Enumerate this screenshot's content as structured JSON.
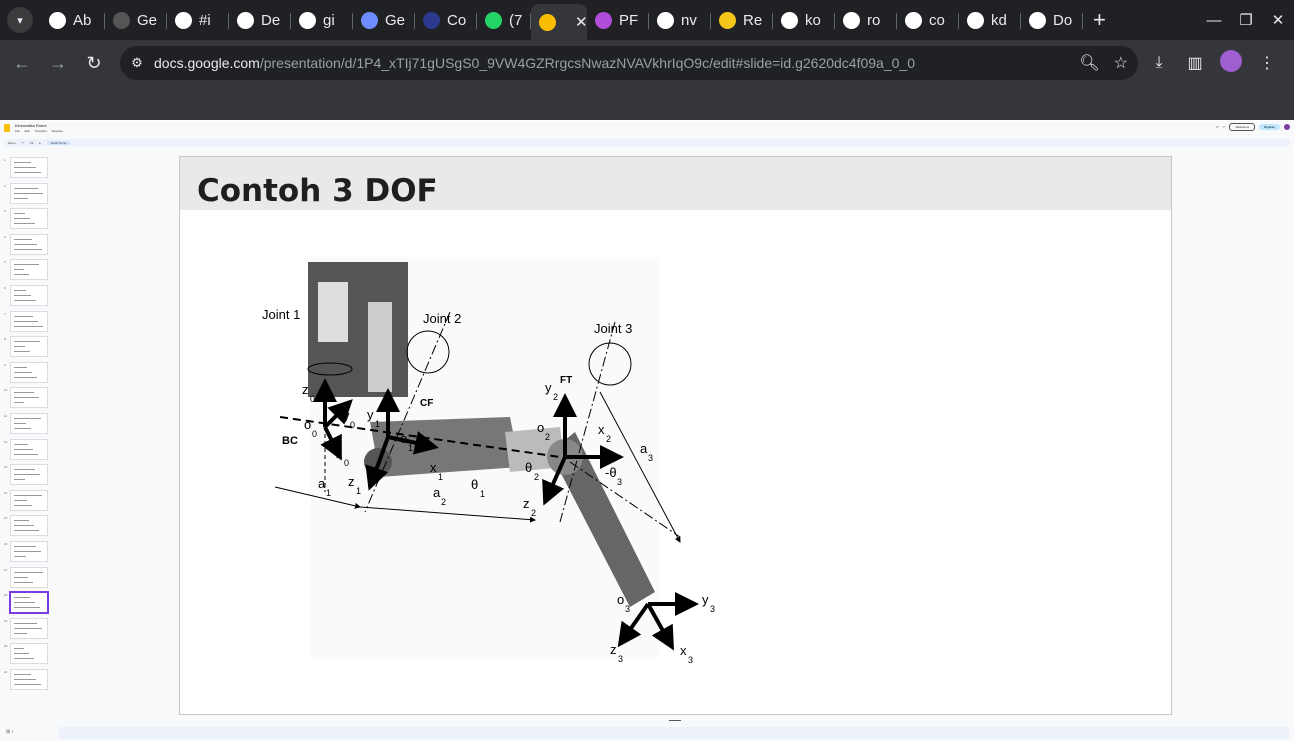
{
  "browser": {
    "tabs": [
      {
        "title": "Ab",
        "fav": "github-icon",
        "color": "#ffffff"
      },
      {
        "title": "Ge",
        "fav": "github-icon",
        "color": "#555555"
      },
      {
        "title": "#i",
        "fav": "hashtag-icon",
        "color": "#ffffff"
      },
      {
        "title": "De",
        "fav": "github-icon",
        "color": "#ffffff"
      },
      {
        "title": "gi",
        "fav": "github-icon",
        "color": "#ffffff"
      },
      {
        "title": "Ge",
        "fav": "gemini-icon",
        "color": "#6f8cff"
      },
      {
        "title": "Co",
        "fav": "its-icon",
        "color": "#2b3a8f"
      },
      {
        "title": "(7",
        "fav": "whatsapp-icon",
        "color": "#25d366"
      },
      {
        "title": "",
        "fav": "slides-icon",
        "color": "#fbbc04",
        "active": true
      },
      {
        "title": "PF",
        "fav": "pf-icon",
        "color": "#b04cd9"
      },
      {
        "title": "nv",
        "fav": "google-icon",
        "color": "#ffffff"
      },
      {
        "title": "Re",
        "fav": "re-icon",
        "color": "#f5c518"
      },
      {
        "title": "ko",
        "fav": "google-icon",
        "color": "#ffffff"
      },
      {
        "title": "ro",
        "fav": "google-icon",
        "color": "#ffffff"
      },
      {
        "title": "co",
        "fav": "google-icon",
        "color": "#ffffff"
      },
      {
        "title": "kd",
        "fav": "google-icon",
        "color": "#ffffff"
      },
      {
        "title": "Do",
        "fav": "download-icon",
        "color": "#ffffff"
      }
    ],
    "url_host": "docs.google.com",
    "url_path": "/presentation/d/1P4_xTIj71gUSgS0_9VW4GZRrgcsNwazNVAVkhrIqO9c/edit#slide=id.g2620dc4f09a_0_0"
  },
  "docs": {
    "title": "Kinematika Robot",
    "menus": "File  Edit  Tampilan  Sisipkan",
    "tools_menu": "Menu",
    "tools_zoom": "Fit",
    "tools_chip": "Ganti Tema",
    "slideshow": "Slideshow",
    "share": "Bagikan"
  },
  "filmstrip": {
    "count": 21,
    "selected": 18
  },
  "slide": {
    "title": "Contoh 3 DOF",
    "figure": {
      "joint1": "Joint 1",
      "joint2": "Joint 2",
      "joint3": "Joint 3",
      "bc": "BC",
      "cf": "CF",
      "ft": "FT"
    }
  }
}
